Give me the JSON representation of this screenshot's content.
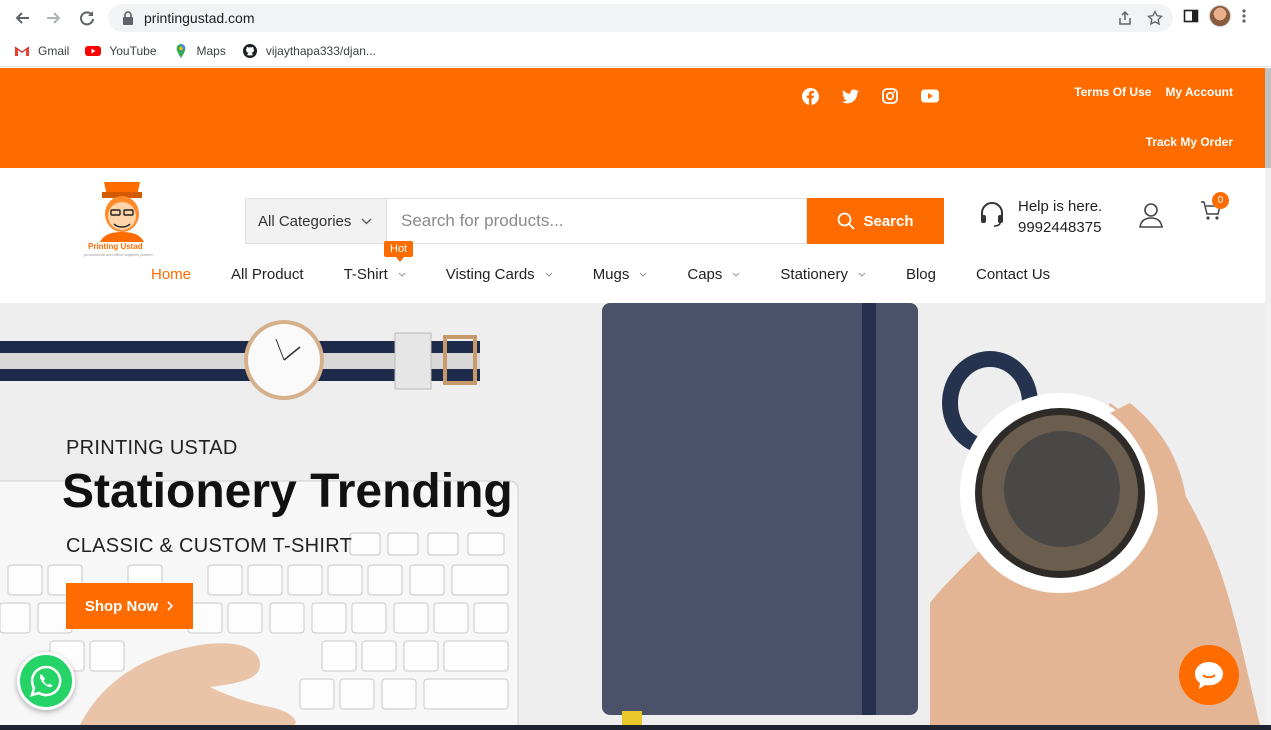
{
  "browser": {
    "url": "printingustad.com",
    "bookmarks": [
      {
        "label": "Gmail",
        "icon": "gmail-icon"
      },
      {
        "label": "YouTube",
        "icon": "youtube-icon"
      },
      {
        "label": "Maps",
        "icon": "maps-icon"
      },
      {
        "label": "vijaythapa333/djan...",
        "icon": "github-icon"
      }
    ]
  },
  "topbar": {
    "social": [
      "facebook-icon",
      "twitter-icon",
      "instagram-icon",
      "youtube-icon"
    ],
    "links": [
      "Terms Of Use",
      "My Account"
    ],
    "track_order": "Track My Order"
  },
  "header": {
    "logo_text": "Printing Ustad",
    "logo_sub": "promotional and office supplies partner",
    "category": "All Categories",
    "search_placeholder": "Search for products...",
    "search_button": "Search",
    "help_title": "Help is here.",
    "help_phone": "9992448375",
    "cart_count": "0"
  },
  "nav": {
    "items": [
      {
        "label": "Home",
        "active": true,
        "dropdown": false
      },
      {
        "label": "All Product",
        "dropdown": false
      },
      {
        "label": "T-Shirt",
        "dropdown": true
      },
      {
        "label": "Visting Cards",
        "dropdown": true
      },
      {
        "label": "Mugs",
        "dropdown": true
      },
      {
        "label": "Caps",
        "dropdown": true
      },
      {
        "label": "Stationery",
        "dropdown": true
      },
      {
        "label": "Blog",
        "dropdown": false
      },
      {
        "label": "Contact Us",
        "dropdown": false
      }
    ],
    "hot_badge": "Hot"
  },
  "hero": {
    "kicker": "PRINTING USTAD",
    "title": "Stationery Trending",
    "subtitle": "CLASSIC & CUSTOM T-SHIRT",
    "button": "Shop Now"
  },
  "colors": {
    "accent": "#fe6c00",
    "whatsapp": "#25d366"
  }
}
